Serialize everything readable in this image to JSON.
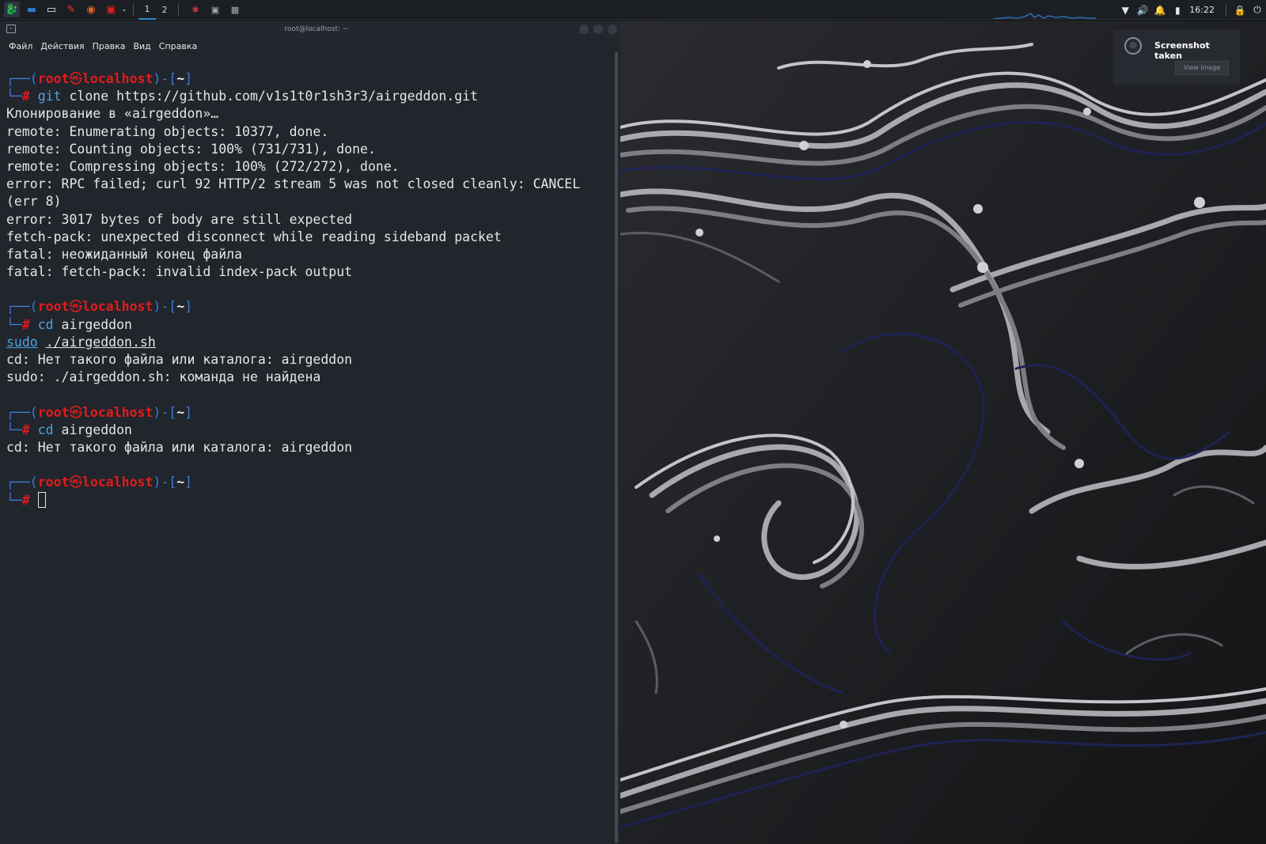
{
  "taskbar": {
    "launchers": [
      {
        "icon": "kali-menu-icon",
        "glyph": "🐉",
        "color": "#2f7cd6"
      },
      {
        "icon": "desktop-icon",
        "glyph": "▬",
        "color": "#2f7cd6"
      },
      {
        "icon": "file-manager-icon",
        "glyph": "▭",
        "color": "#e9eef5"
      },
      {
        "icon": "text-editor-icon",
        "glyph": "✎",
        "color": "#e33"
      },
      {
        "icon": "firefox-icon",
        "glyph": "◉",
        "color": "#e0622b"
      },
      {
        "icon": "terminal-launcher-icon",
        "glyph": "▣",
        "color": "#d22"
      }
    ],
    "workspaces": [
      {
        "label": "1",
        "active": true
      },
      {
        "label": "2",
        "active": false
      }
    ],
    "clock": "16:22",
    "tray_icons": [
      "network-icon",
      "volume-icon",
      "notifications-icon",
      "battery-icon",
      "lock-icon",
      "power-icon"
    ]
  },
  "terminal": {
    "title": "root@localhost: ~",
    "menu": [
      "Файл",
      "Действия",
      "Правка",
      "Вид",
      "Справка"
    ],
    "prompt": {
      "frame_top": "┌──(",
      "user": "root",
      "skull": "㉿",
      "host": "localhost",
      "mid": ")-[",
      "dir": "~",
      "end": "]",
      "frame_bottom": "└─",
      "hash": "#"
    },
    "blocks": [
      {
        "cmd_name": "git",
        "cmd_args": " clone https://github.com/v1s1t0r1sh3r3/airgeddon.git",
        "output": [
          "Клонирование в «airgeddon»…",
          "remote: Enumerating objects: 10377, done.",
          "remote: Counting objects: 100% (731/731), done.",
          "remote: Compressing objects: 100% (272/272), done.",
          "error: RPC failed; curl 92 HTTP/2 stream 5 was not closed cleanly: CANCEL",
          "(err 8)",
          "error: 3017 bytes of body are still expected",
          "fetch-pack: unexpected disconnect while reading sideband packet",
          "fatal: неожиданный конец файла",
          "fatal: fetch-pack: invalid index-pack output"
        ]
      },
      {
        "cmd_name": "cd",
        "cmd_args": " airgeddon",
        "cont_sudo": "sudo",
        "cont_args": "./airgeddon.sh",
        "output": [
          "cd: Нет такого файла или каталога: airgeddon",
          "sudo: ./airgeddon.sh: команда не найдена"
        ]
      },
      {
        "cmd_name": "cd",
        "cmd_args": " airgeddon",
        "output": [
          "cd: Нет такого файла или каталога: airgeddon"
        ]
      }
    ]
  },
  "notification": {
    "title": "Screenshot taken",
    "button": "View image"
  }
}
